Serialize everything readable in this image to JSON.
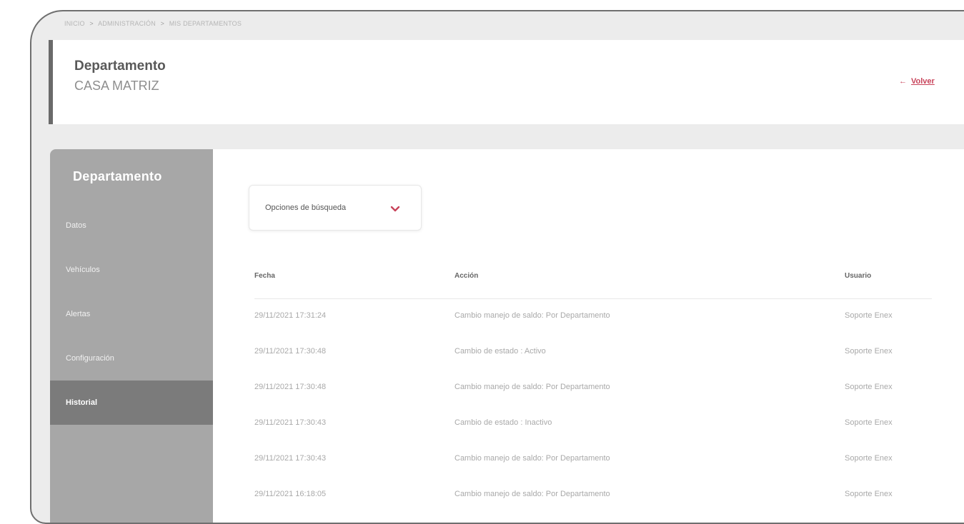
{
  "breadcrumb": {
    "items": [
      "INICIO",
      "ADMINISTRACIÓN",
      "MIS DEPARTAMENTOS"
    ],
    "separator": ">"
  },
  "header": {
    "title": "Departamento",
    "subtitle": "CASA MATRIZ",
    "back_arrow": "←",
    "back_label": "Volver"
  },
  "sidebar": {
    "title": "Departamento",
    "items": [
      {
        "label": "Datos",
        "active": false
      },
      {
        "label": "Vehículos",
        "active": false
      },
      {
        "label": "Alertas",
        "active": false
      },
      {
        "label": "Configuración",
        "active": false
      },
      {
        "label": "Historial",
        "active": true
      }
    ]
  },
  "search": {
    "label": "Opciones de búsqueda",
    "icon": "chevron-down-icon"
  },
  "table": {
    "headers": [
      "Fecha",
      "Acción",
      "Usuario"
    ],
    "rows": [
      {
        "fecha": "29/11/2021 17:31:24",
        "accion": "Cambio manejo de saldo: Por Departamento",
        "usuario": "Soporte Enex"
      },
      {
        "fecha": "29/11/2021 17:30:48",
        "accion": "Cambio de estado : Activo",
        "usuario": "Soporte Enex"
      },
      {
        "fecha": "29/11/2021 17:30:48",
        "accion": "Cambio manejo de saldo: Por Departamento",
        "usuario": "Soporte Enex"
      },
      {
        "fecha": "29/11/2021 17:30:43",
        "accion": "Cambio de estado : Inactivo",
        "usuario": "Soporte Enex"
      },
      {
        "fecha": "29/11/2021 17:30:43",
        "accion": "Cambio manejo de saldo: Por Departamento",
        "usuario": "Soporte Enex"
      },
      {
        "fecha": "29/11/2021 16:18:05",
        "accion": "Cambio manejo de saldo: Por Departamento",
        "usuario": "Soporte Enex"
      }
    ]
  },
  "colors": {
    "accent": "#c8435a",
    "sidebar_bg": "#a7a7a7",
    "sidebar_active": "#7b7b7b"
  }
}
